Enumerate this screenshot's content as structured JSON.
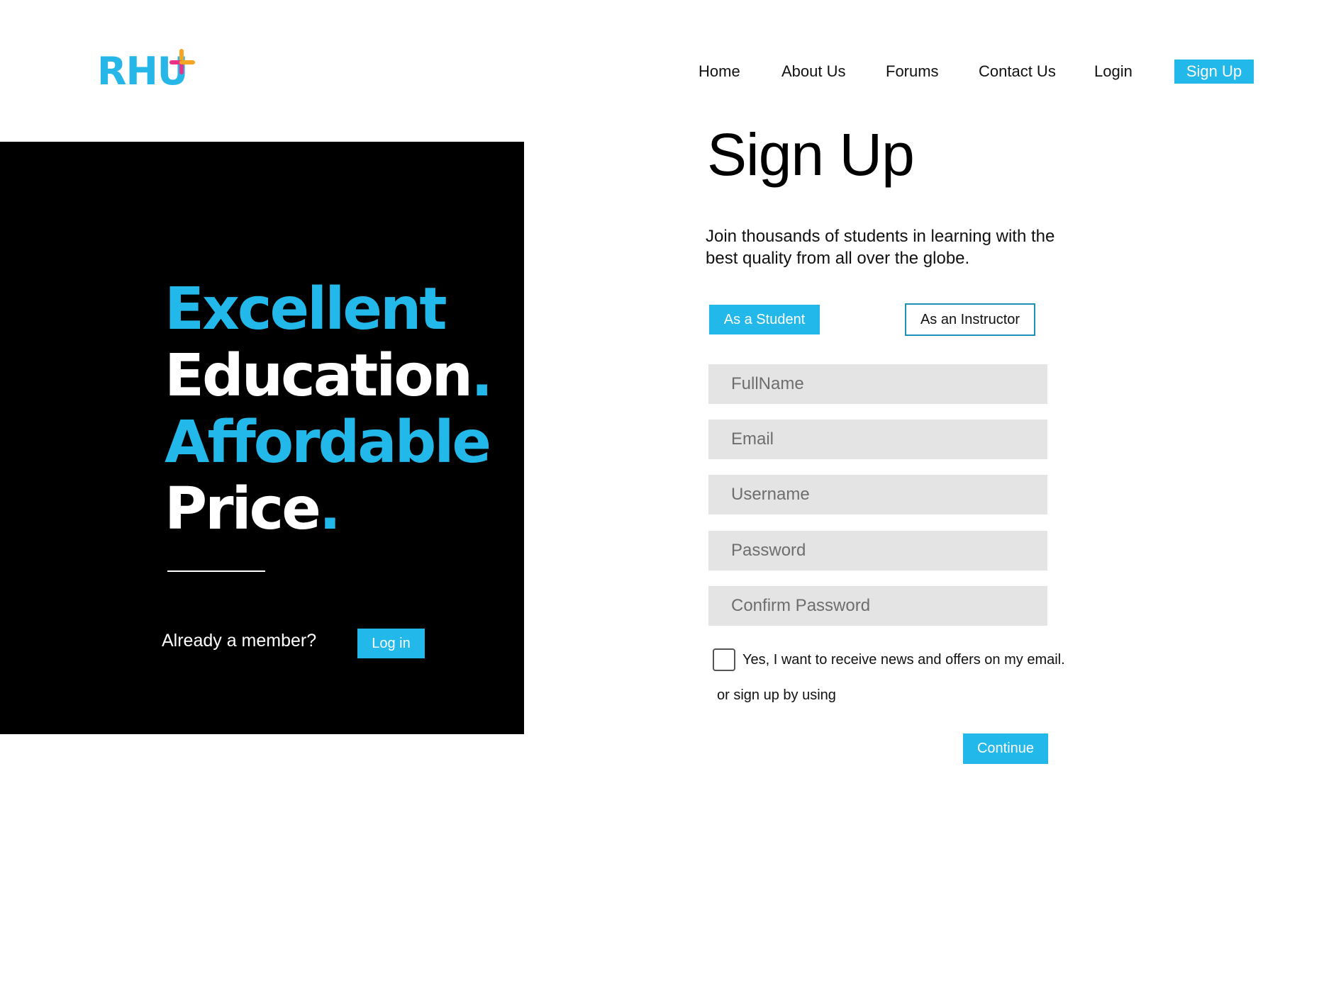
{
  "brand": {
    "logo_text": "RHU",
    "accent": "#22b8e9",
    "logo_plus_colors": [
      "#e9338b",
      "#f6a623",
      "#22b8e9"
    ]
  },
  "nav": {
    "items": [
      {
        "label": "Home"
      },
      {
        "label": "About Us"
      },
      {
        "label": "Forums"
      },
      {
        "label": "Contact Us"
      },
      {
        "label": "Login"
      }
    ],
    "signup_label": "Sign Up"
  },
  "hero": {
    "lines": [
      {
        "text": "Excellent",
        "dot": ""
      },
      {
        "text": "Education",
        "dot": "."
      },
      {
        "text": "Affordable",
        "dot": ""
      },
      {
        "text": "Price",
        "dot": "."
      }
    ],
    "member_text": "Already a member?",
    "login_label": "Log in"
  },
  "form": {
    "title": "Sign Up",
    "subtitle": "Join thousands of students in learning with the best quality from all over the globe.",
    "roles": {
      "student": "As a Student",
      "instructor": "As an Instructor",
      "selected": "student"
    },
    "fields": {
      "fullname": {
        "placeholder": "FullName",
        "value": ""
      },
      "email": {
        "placeholder": "Email",
        "value": ""
      },
      "username": {
        "placeholder": "Username",
        "value": ""
      },
      "password": {
        "placeholder": "Password",
        "value": ""
      },
      "confirm_password": {
        "placeholder": "Confirm Password",
        "value": ""
      }
    },
    "newsletter": {
      "label": "Yes, I want to receive news and offers on my email.",
      "checked": false
    },
    "alt_signup_text": "or sign up by using",
    "continue_label": "Continue"
  }
}
